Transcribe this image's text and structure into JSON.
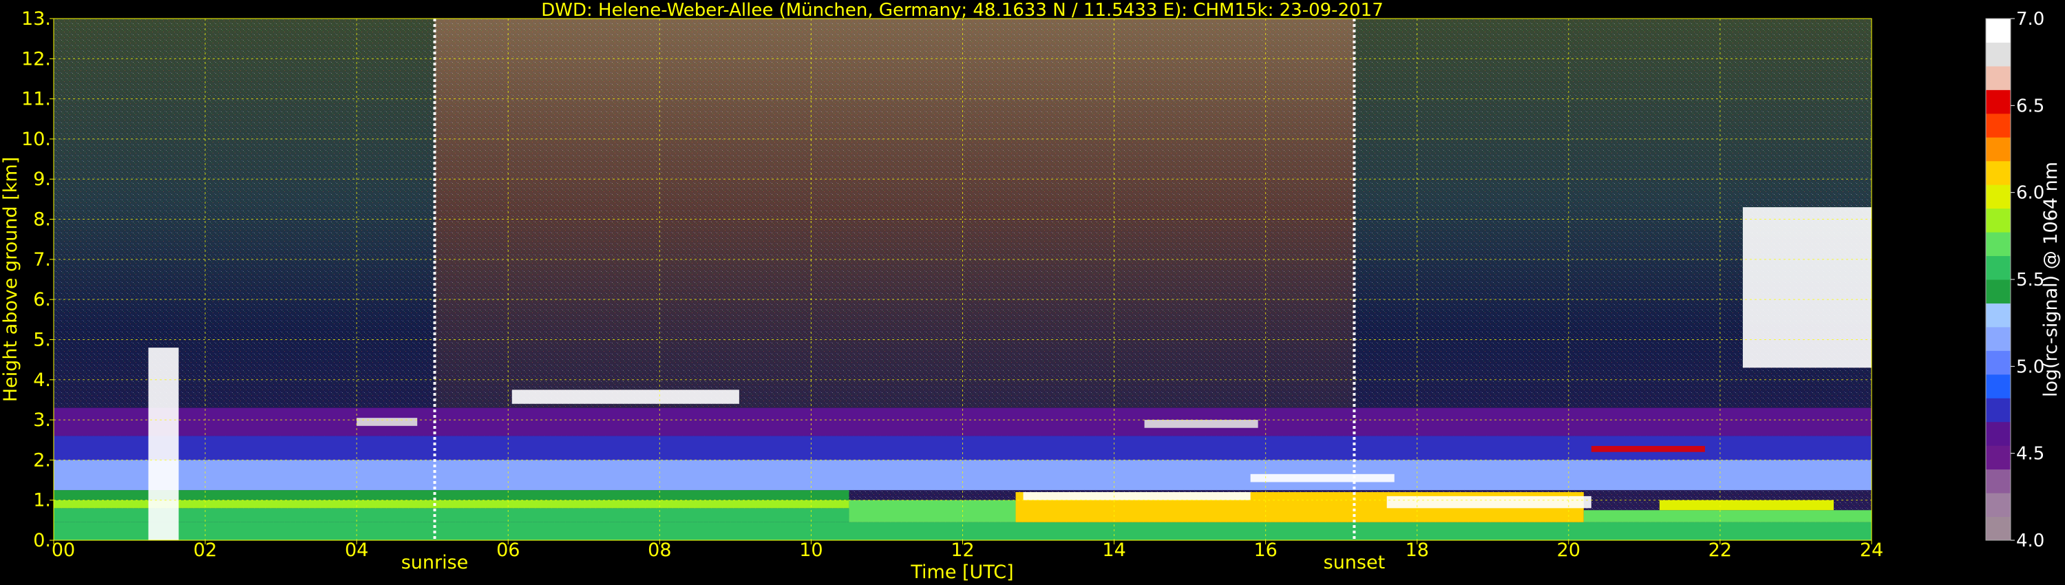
{
  "chart_data": {
    "type": "heatmap",
    "title": "DWD: Helene-Weber-Allee (München, Germany; 48.1633 N / 11.5433 E):    CHM15k: 23-09-2017",
    "xlabel": "Time [UTC]",
    "ylabel": "Height above ground [km]",
    "xlim": [
      0,
      24
    ],
    "ylim": [
      0,
      13
    ],
    "x_ticks": [
      {
        "v": 0,
        "label": "00"
      },
      {
        "v": 2,
        "label": "02"
      },
      {
        "v": 4,
        "label": "04"
      },
      {
        "v": 6,
        "label": "06"
      },
      {
        "v": 8,
        "label": "08"
      },
      {
        "v": 10,
        "label": "10"
      },
      {
        "v": 12,
        "label": "12"
      },
      {
        "v": 14,
        "label": "14"
      },
      {
        "v": 16,
        "label": "16"
      },
      {
        "v": 18,
        "label": "18"
      },
      {
        "v": 20,
        "label": "20"
      },
      {
        "v": 22,
        "label": "22"
      },
      {
        "v": 24,
        "label": "24"
      }
    ],
    "y_ticks": [
      {
        "v": 0,
        "label": "0."
      },
      {
        "v": 1,
        "label": "1."
      },
      {
        "v": 2,
        "label": "2."
      },
      {
        "v": 3,
        "label": "3."
      },
      {
        "v": 4,
        "label": "4."
      },
      {
        "v": 5,
        "label": "5."
      },
      {
        "v": 6,
        "label": "6."
      },
      {
        "v": 7,
        "label": "7."
      },
      {
        "v": 8,
        "label": "8."
      },
      {
        "v": 9,
        "label": "9."
      },
      {
        "v": 10,
        "label": "10."
      },
      {
        "v": 11,
        "label": "11."
      },
      {
        "v": 12,
        "label": "12."
      },
      {
        "v": 13,
        "label": "13."
      }
    ],
    "grid": true,
    "annotations": [
      {
        "type": "vline",
        "x": 5.03,
        "label": "sunrise"
      },
      {
        "type": "vline",
        "x": 17.17,
        "label": "sunset"
      }
    ],
    "colorbar": {
      "label": "log(rc-signal) @ 1064 nm",
      "range": [
        4.0,
        7.0
      ],
      "ticks": [
        {
          "v": 4.0,
          "label": "4.0"
        },
        {
          "v": 4.5,
          "label": "4.5"
        },
        {
          "v": 5.0,
          "label": "5.0"
        },
        {
          "v": 5.5,
          "label": "5.5"
        },
        {
          "v": 6.0,
          "label": "6.0"
        },
        {
          "v": 6.5,
          "label": "6.5"
        },
        {
          "v": 7.0,
          "label": "7.0"
        }
      ],
      "colors": [
        "#a08a98",
        "#9f7fa1",
        "#8e5c9a",
        "#6a1a8c",
        "#5a1490",
        "#3030c0",
        "#2060ff",
        "#6080ff",
        "#8aa8ff",
        "#a0c8ff",
        "#20a040",
        "#30c060",
        "#60e060",
        "#a0f020",
        "#e0f000",
        "#ffd000",
        "#ff9000",
        "#ff4000",
        "#e00000",
        "#f0c0b0",
        "#e0e0e0",
        "#ffffff"
      ]
    },
    "layers": [
      {
        "x0": 0,
        "x1": 24,
        "y0": 0,
        "y1": 0.45,
        "value": 5.5
      },
      {
        "x0": 0,
        "x1": 10.5,
        "y0": 0.45,
        "y1": 0.8,
        "value": 5.6
      },
      {
        "x0": 0,
        "x1": 10.5,
        "y0": 0.8,
        "y1": 1.0,
        "value": 5.9
      },
      {
        "x0": 0,
        "x1": 10.5,
        "y0": 1.0,
        "y1": 1.25,
        "value": 5.4
      },
      {
        "x0": 0,
        "x1": 24,
        "y0": 1.25,
        "y1": 2.0,
        "value": 5.1
      },
      {
        "x0": 0,
        "x1": 24,
        "y0": 2.0,
        "y1": 2.6,
        "value": 4.75
      },
      {
        "x0": 0,
        "x1": 24,
        "y0": 2.6,
        "y1": 3.3,
        "value": 4.55
      },
      {
        "x0": 10.5,
        "x1": 12.7,
        "y0": 0.45,
        "y1": 1.0,
        "value": 5.7
      },
      {
        "x0": 12.7,
        "x1": 20.2,
        "y0": 0.45,
        "y1": 1.2,
        "value": 6.05
      },
      {
        "x0": 20.2,
        "x1": 24,
        "y0": 0.45,
        "y1": 0.75,
        "value": 5.7
      },
      {
        "x0": 21.2,
        "x1": 23.5,
        "y0": 0.75,
        "y1": 1.0,
        "value": 6.0
      }
    ],
    "cloud_layers": [
      {
        "x0": 6.05,
        "x1": 9.05,
        "y0": 3.4,
        "y1": 3.75,
        "value": 7.0
      },
      {
        "x0": 4.0,
        "x1": 4.8,
        "y0": 2.85,
        "y1": 3.05,
        "value": 6.8
      },
      {
        "x0": 14.4,
        "x1": 15.9,
        "y0": 2.8,
        "y1": 3.0,
        "value": 6.8
      },
      {
        "x0": 15.8,
        "x1": 17.7,
        "y0": 1.45,
        "y1": 1.65,
        "value": 7.0
      },
      {
        "x0": 12.8,
        "x1": 15.8,
        "y0": 1.0,
        "y1": 1.2,
        "value": 7.0
      },
      {
        "x0": 17.6,
        "x1": 20.3,
        "y0": 0.8,
        "y1": 1.1,
        "value": 6.9
      },
      {
        "x0": 20.3,
        "x1": 21.8,
        "y0": 2.2,
        "y1": 2.35,
        "value": 6.5
      },
      {
        "x0": 22.3,
        "x1": 24.0,
        "y0": 4.3,
        "y1": 8.3,
        "value": 7.0
      },
      {
        "x0": 1.25,
        "x1": 1.65,
        "y0": 0.0,
        "y1": 4.8,
        "value": 7.0
      }
    ]
  }
}
